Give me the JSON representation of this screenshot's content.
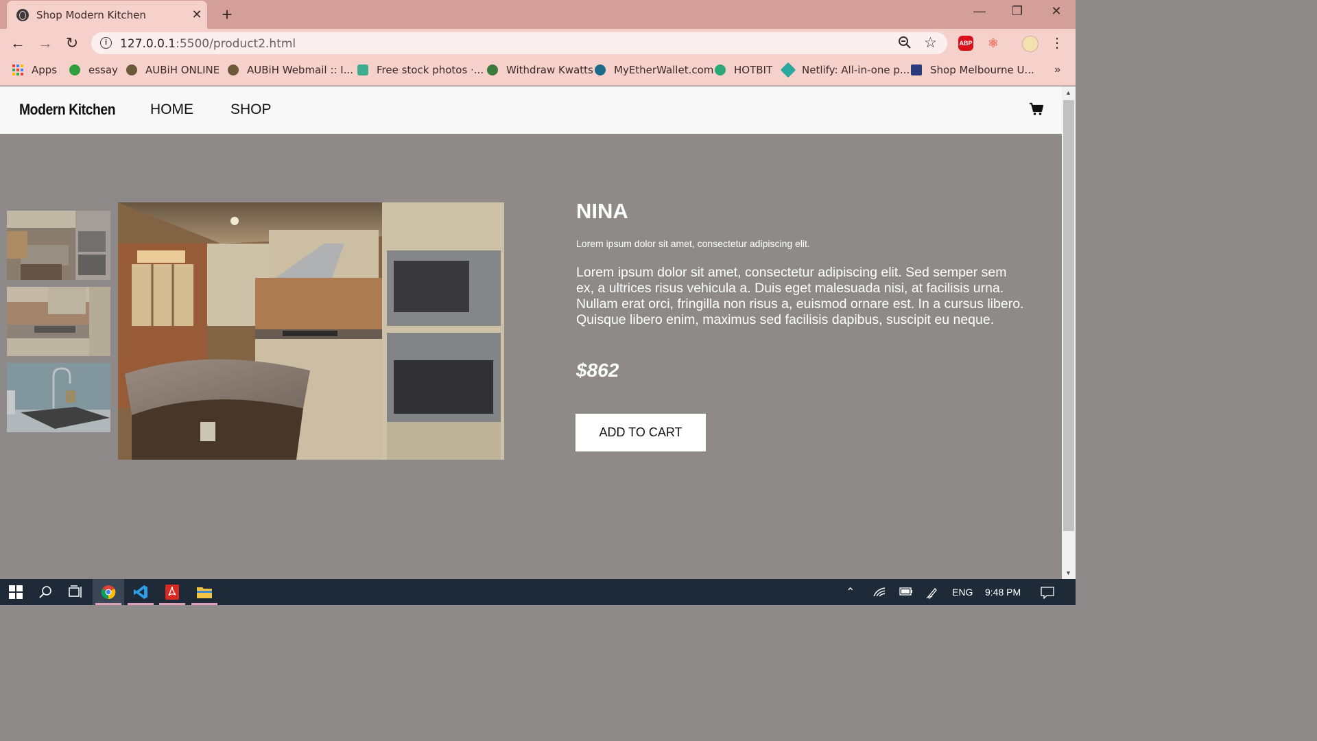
{
  "browser": {
    "tab_title": "Shop Modern Kitchen",
    "new_tab_icon": "plus-icon",
    "url_host": "127.0.0.1",
    "url_path": ":5500/product2.html",
    "bookmarks": [
      {
        "label": "Apps",
        "color": "#4285f4"
      },
      {
        "label": "essay",
        "color": "#2e9e3e"
      },
      {
        "label": "AUBiH ONLINE",
        "color": "#6b5a3a"
      },
      {
        "label": "AUBiH Webmail :: I...",
        "color": "#6b5a3a"
      },
      {
        "label": "Free stock photos ·...",
        "color": "#3cae8f"
      },
      {
        "label": "Withdraw Kwatts",
        "color": "#3a7a3a"
      },
      {
        "label": "MyEtherWallet.com",
        "color": "#1a6a8a"
      },
      {
        "label": "HOTBIT",
        "color": "#2aa87a"
      },
      {
        "label": "Netlify: All-in-one p...",
        "color": "#2aa8a0"
      },
      {
        "label": "Shop Melbourne U...",
        "color": "#2a3a7a"
      }
    ],
    "bookmarks_more": "»",
    "extension_abp": "ABP"
  },
  "site": {
    "logo": "Modern Kitchen",
    "nav": {
      "home": "HOME",
      "shop": "SHOP"
    }
  },
  "product": {
    "name": "NINA",
    "subtitle": "Lorem ipsum dolor sit amet, consectetur adipiscing elit.",
    "description": "Lorem ipsum dolor sit amet, consectetur adipiscing elit. Sed semper sem ex, a ultrices risus vehicula a. Duis eget malesuada nisi, at facilisis urna. Nullam erat orci, fringilla non risus a, euismod ornare est. In a cursus libero. Quisque libero enim, maximus sed facilisis dapibus, suscipit eu neque.",
    "price": "$862",
    "add_to_cart": "ADD TO CART"
  },
  "taskbar": {
    "language": "ENG",
    "time": "9:48 PM"
  }
}
